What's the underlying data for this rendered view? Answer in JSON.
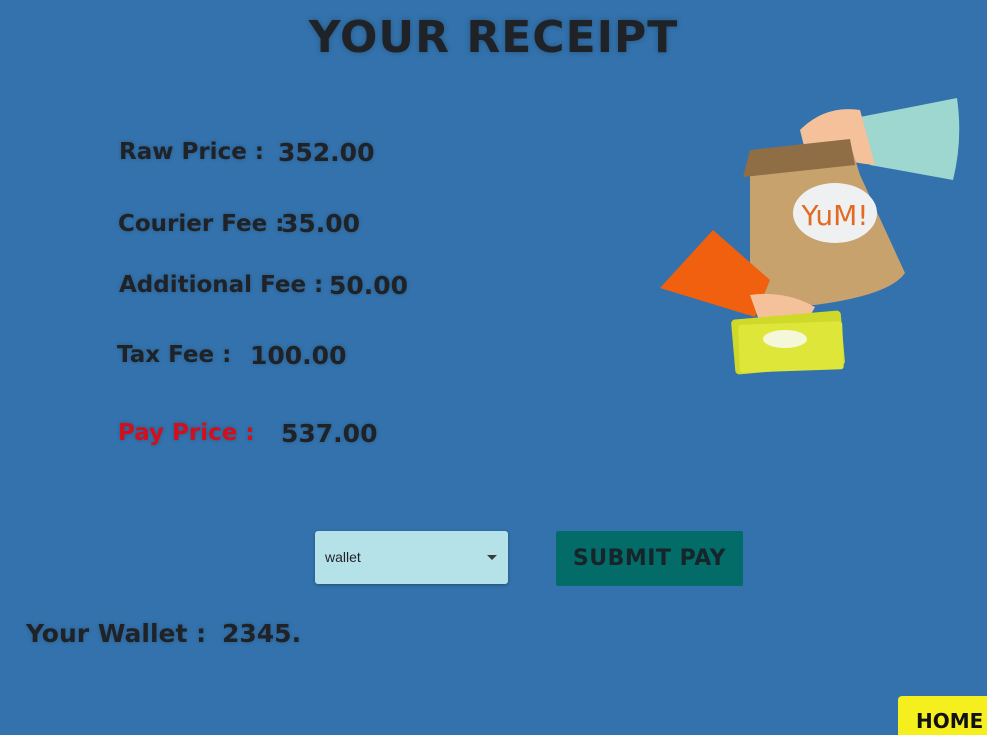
{
  "title": "YOUR RECEIPT",
  "receipt": {
    "raw_label": "Raw Price :",
    "raw_value": "352.00",
    "courier_label": "Courier Fee :",
    "courier_value": "35.00",
    "additional_label": "Additional Fee :",
    "additional_value": "50.00",
    "tax_label": "Tax Fee :",
    "tax_value": "100.00",
    "pay_label": "Pay Price :",
    "pay_value": "537.00"
  },
  "payment": {
    "method_selected": "wallet",
    "submit_label": "SUBMIT PAY"
  },
  "wallet": {
    "label": "Your Wallet :",
    "value": "2345."
  },
  "illustration": {
    "bag_text": "YuM!"
  },
  "nav": {
    "home_label": "HOME"
  },
  "colors": {
    "background": "#3372ac",
    "pay_label": "#d1101e",
    "select_bg": "#b5e2e9",
    "submit_bg": "#036b68",
    "home_bg": "#f6ef1e"
  }
}
